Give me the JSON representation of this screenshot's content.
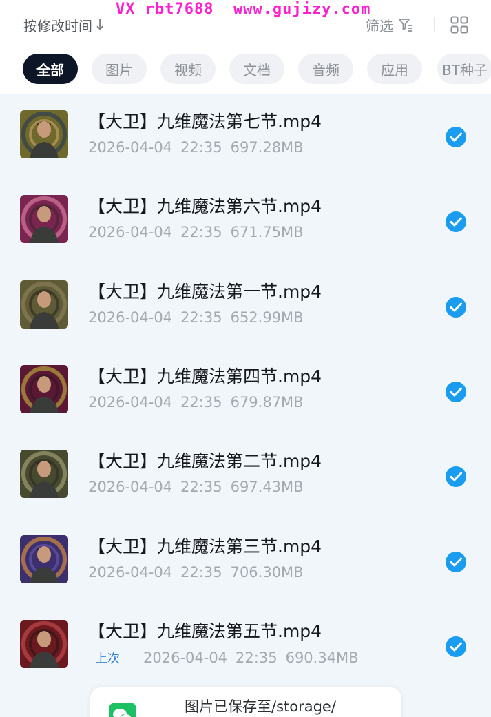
{
  "watermark": "VX rbt7688  www.gujizy.com",
  "sort": {
    "label": "按修改时间",
    "arrow": "↓"
  },
  "filter": {
    "label": "筛选",
    "icon": "filter-icon"
  },
  "view_toggle": {
    "icon": "grid-view-icon"
  },
  "categories": [
    {
      "label": "全部",
      "active": true
    },
    {
      "label": "图片",
      "active": false
    },
    {
      "label": "视频",
      "active": false
    },
    {
      "label": "文档",
      "active": false
    },
    {
      "label": "音频",
      "active": false
    },
    {
      "label": "应用",
      "active": false
    },
    {
      "label": "BT种子",
      "active": false
    }
  ],
  "files": [
    {
      "name": "【大卫】九维魔法第七节.mp4",
      "date": "2026-04-04",
      "time": "22:35",
      "size": "697.28MB",
      "selected": true,
      "tag": ""
    },
    {
      "name": "【大卫】九维魔法第六节.mp4",
      "date": "2026-04-04",
      "time": "22:35",
      "size": "671.75MB",
      "selected": true,
      "tag": ""
    },
    {
      "name": "【大卫】九维魔法第一节.mp4",
      "date": "2026-04-04",
      "time": "22:35",
      "size": "652.99MB",
      "selected": true,
      "tag": ""
    },
    {
      "name": "【大卫】九维魔法第四节.mp4",
      "date": "2026-04-04",
      "time": "22:35",
      "size": "679.87MB",
      "selected": true,
      "tag": ""
    },
    {
      "name": "【大卫】九维魔法第二节.mp4",
      "date": "2026-04-04",
      "time": "22:35",
      "size": "697.43MB",
      "selected": true,
      "tag": ""
    },
    {
      "name": "【大卫】九维魔法第三节.mp4",
      "date": "2026-04-04",
      "time": "22:35",
      "size": "706.30MB",
      "selected": true,
      "tag": ""
    },
    {
      "name": "【大卫】九维魔法第五节.mp4",
      "date": "2026-04-04",
      "time": "22:35",
      "size": "690.34MB",
      "selected": true,
      "tag": "上次"
    }
  ],
  "toast": {
    "text": "图片已保存至/storage/",
    "icon": "wechat-icon"
  },
  "colors": {
    "accent": "#1a9cf0",
    "chip_active_bg": "#0d1626",
    "list_bg": "#f1f6fb"
  }
}
